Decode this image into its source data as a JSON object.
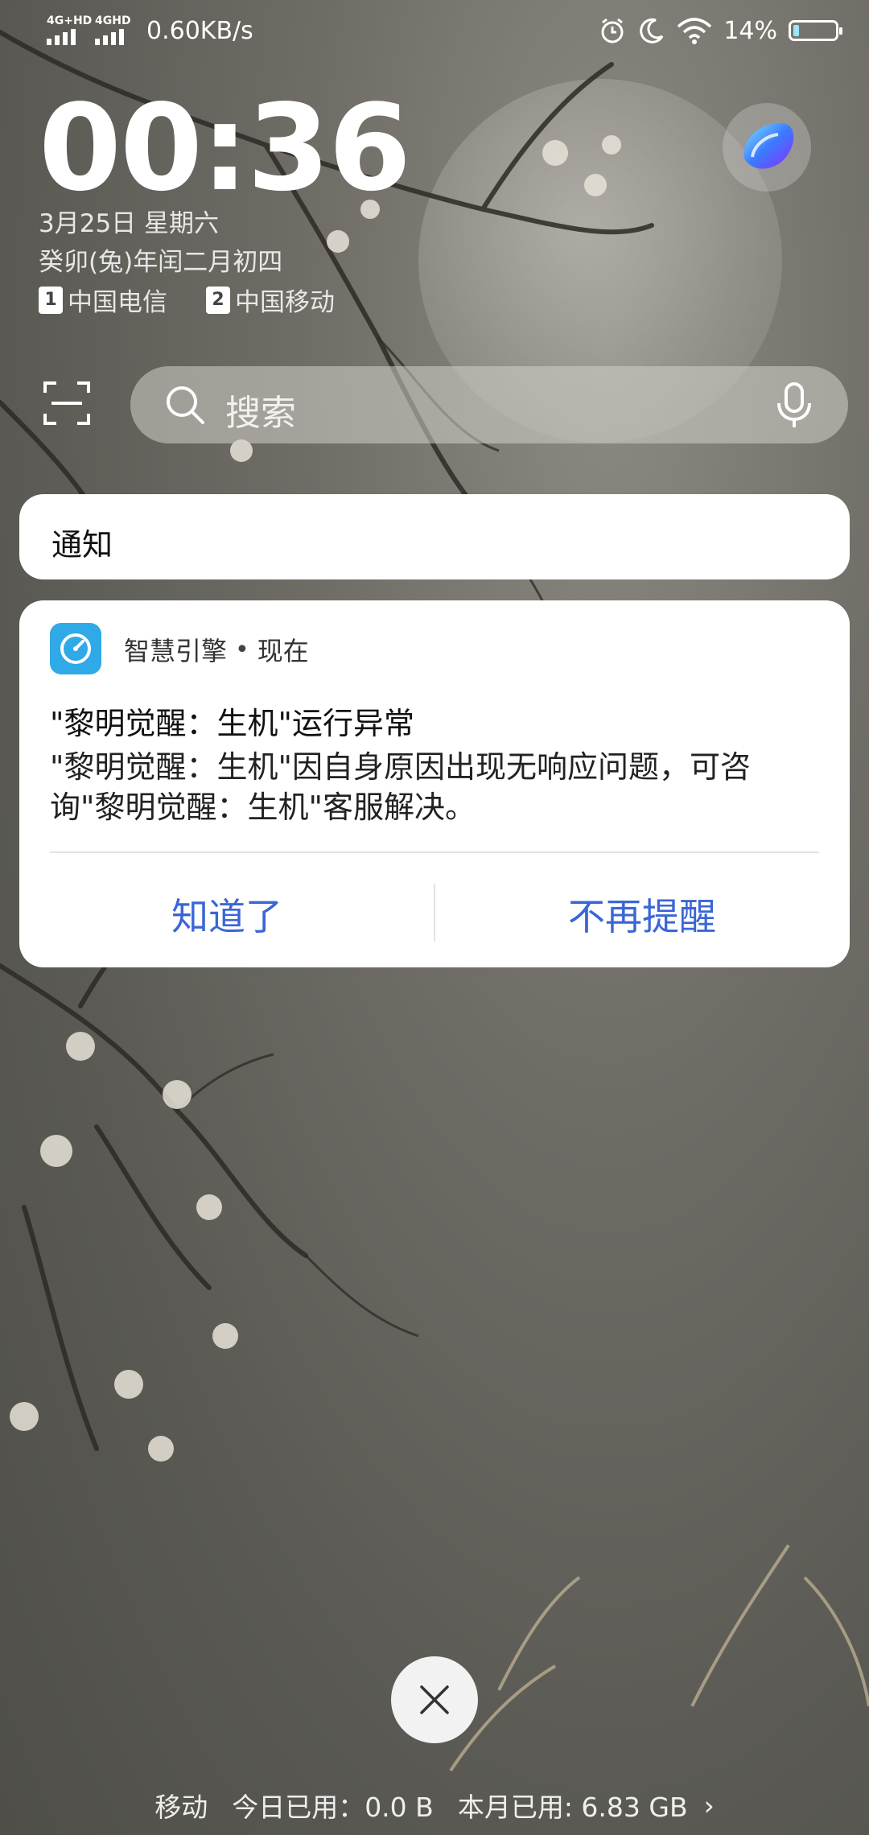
{
  "status_bar": {
    "sim1_network": "4G+HD",
    "sim2_network": "4GHD",
    "net_speed": "0.60KB/s",
    "battery_percent": "14%",
    "battery_level": 0.14,
    "icons": [
      "alarm-icon",
      "moon-icon",
      "wifi-icon",
      "battery-icon"
    ]
  },
  "lockscreen": {
    "time": "00:36",
    "date": "3月25日 星期六",
    "lunar_date": "癸卯(兔)年闰二月初四",
    "sim1_number": "1",
    "sim1_carrier": "中国电信",
    "sim2_number": "2",
    "sim2_carrier": "中国移动"
  },
  "search": {
    "placeholder": "搜索"
  },
  "notifications_header": {
    "label": "通知"
  },
  "notification": {
    "app_name": "智慧引擎",
    "separator": "•",
    "time": "现在",
    "title": "\"黎明觉醒：生机\"运行异常",
    "body": "\"黎明觉醒：生机\"因自身原因出现无响应问题，可咨询\"黎明觉醒：生机\"客服解决。",
    "action_ok": "知道了",
    "action_mute": "不再提醒"
  },
  "data_usage": {
    "carrier": "移动",
    "today": "今日已用：0.0 B",
    "month": "本月已用: 6.83 GB",
    "chevron": "›"
  },
  "colors": {
    "action_blue": "#3a66d6",
    "app_icon_blue": "#2fa9e8",
    "card_bg": "#ffffff"
  }
}
